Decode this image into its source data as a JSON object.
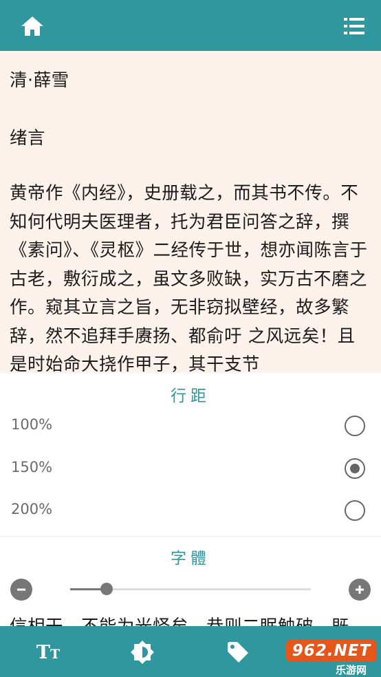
{
  "header": {
    "home_icon": "home-icon",
    "menu_icon": "list-menu-icon",
    "bar_color": "#2f979d"
  },
  "reader": {
    "author": "清·薛雪",
    "chapter": "绪言",
    "body": "黄帝作《内经》，史册载之，而其书不传。不知何代明夫医理者，托为君臣问答之辞，撰《素问》、《灵枢》二经传于世，想亦闻陈言于古老，敷衍成之，虽文多败缺，实万古不磨之作。窥其立言之旨，无非窃拟壁经，故多繁辞，然不追拜手赓扬、都俞吁 之风远矣！且是时始命大挠作甲子，其干支节",
    "below_panel_text": "信相干，不能为光怪矣。恭则二眠触破，既"
  },
  "settings": {
    "line_spacing_title": "行距",
    "line_spacing_options": [
      {
        "label": "100%",
        "selected": false
      },
      {
        "label": "150%",
        "selected": true
      },
      {
        "label": "200%",
        "selected": false
      }
    ],
    "font_title": "字體",
    "font_size_level": 0.15
  },
  "toolbar": {
    "font_icon_big": "T",
    "font_icon_small": "T",
    "items": [
      "font-size-icon",
      "brightness-icon",
      "tag-icon",
      "next-icon"
    ]
  },
  "watermark": {
    "main": "962.NET",
    "sub": "乐游网"
  },
  "colors": {
    "accent": "#2f979d",
    "reader_bg": "#fdf1ec",
    "watermark": "#e6561a"
  }
}
